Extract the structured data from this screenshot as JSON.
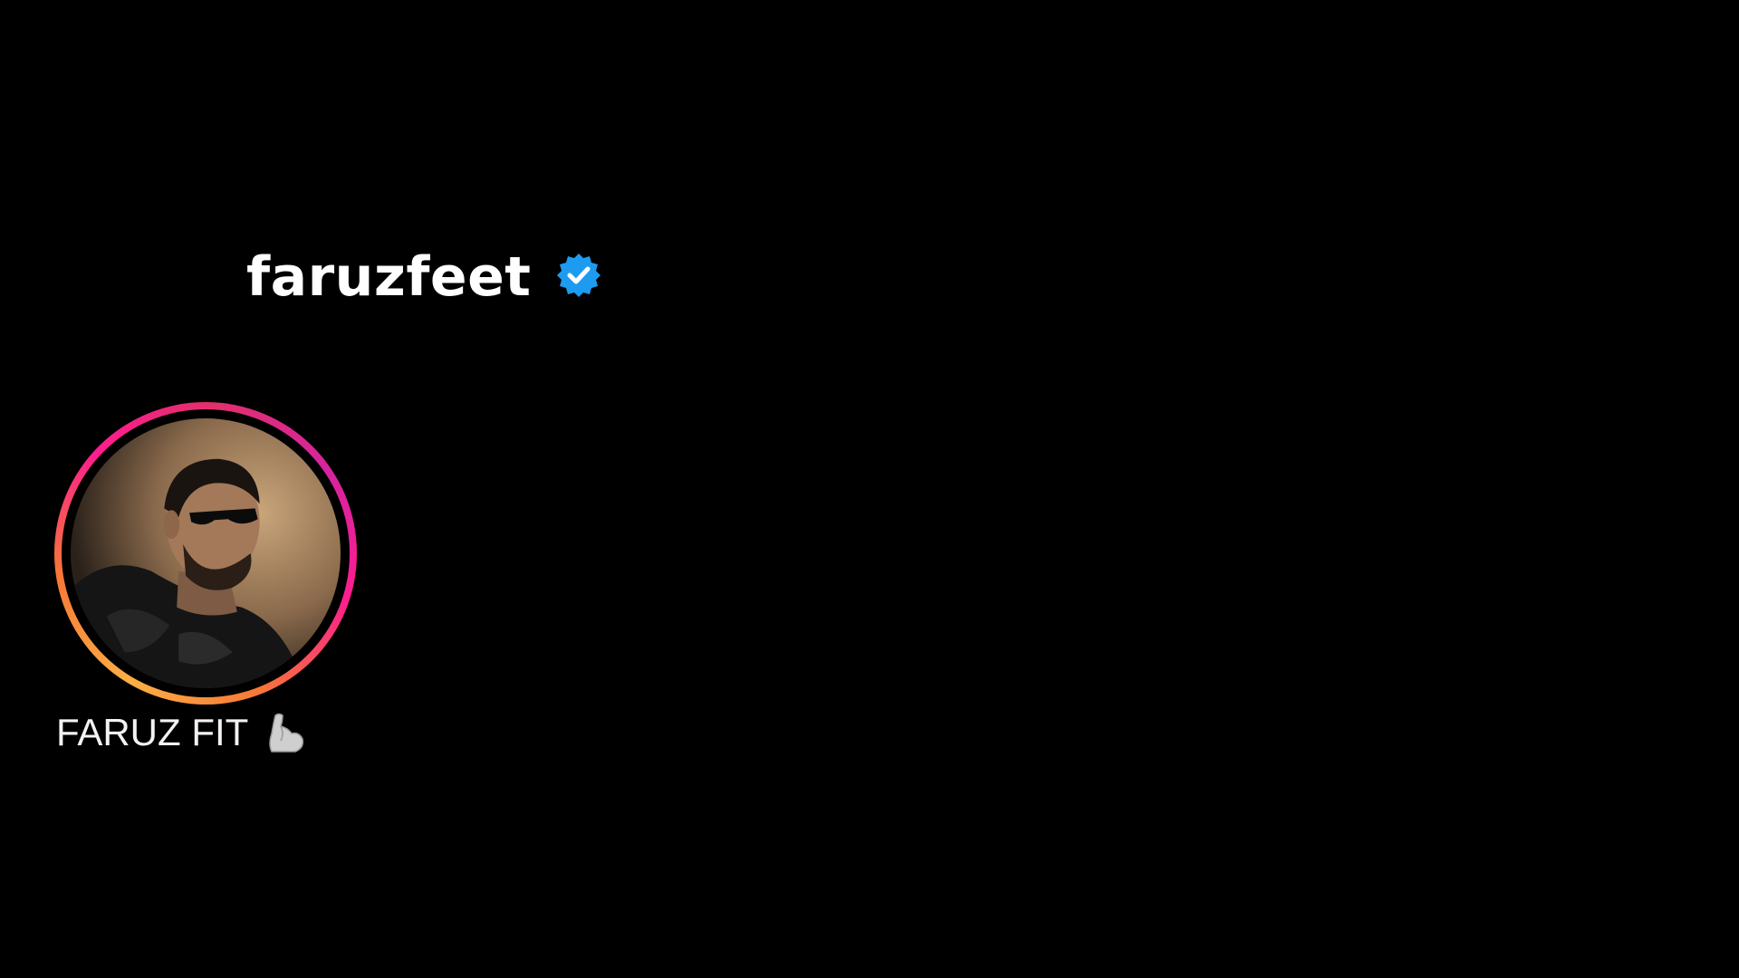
{
  "profile": {
    "username": "faruzfeet",
    "verified": true,
    "verified_icon": "verified-badge-icon"
  },
  "story": {
    "label": "FARUZ FIT",
    "emoji_icon": "flexed-biceps-icon",
    "ring_colors": [
      "#fd1d8f",
      "#e1306c",
      "#f77737",
      "#fcaf45"
    ]
  },
  "colors": {
    "background": "#000000",
    "text": "#ffffff",
    "verified": "#1d9bf0"
  }
}
